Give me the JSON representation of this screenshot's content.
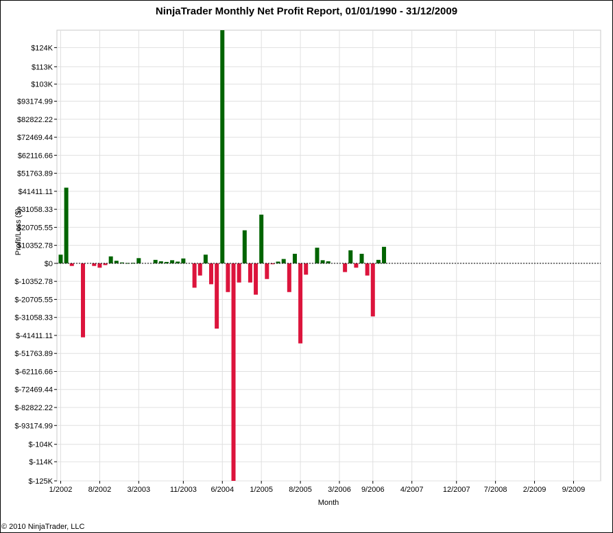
{
  "footer": "© 2010 NinjaTrader, LLC",
  "colors": {
    "positive": "#006400",
    "negative": "#DC143C",
    "grid": "#E0E0E0"
  },
  "chart_data": {
    "type": "bar",
    "title": "NinjaTrader Monthly Net Profit Report, 01/01/1990 - 31/12/2009",
    "xlabel": "Month",
    "ylabel": "Profit/Loss ($)",
    "grid": true,
    "ylim": [
      -125000,
      134000
    ],
    "y_tick_values": [
      124000,
      113000,
      103000,
      93174.99,
      82822.22,
      72469.44,
      62116.66,
      51763.89,
      41411.11,
      31058.33,
      20705.55,
      10352.78,
      0,
      -10352.78,
      -20705.55,
      -31058.33,
      -41411.11,
      -51763.89,
      -62116.66,
      -72469.44,
      -82822.22,
      -93174.99,
      -104000,
      -114000,
      -125000
    ],
    "y_tick_labels": [
      "$124K",
      "$113K",
      "$103K",
      "$93174.99",
      "$82822.22",
      "$72469.44",
      "$62116.66",
      "$51763.89",
      "$41411.11",
      "$31058.33",
      "$20705.55",
      "$10352.78",
      "$0",
      "$-10352.78",
      "$-20705.55",
      "$-31058.33",
      "$-41411.11",
      "$-51763.89",
      "$-62116.66",
      "$-72469.44",
      "$-82822.22",
      "$-93174.99",
      "$-104K",
      "$-114K",
      "$-125K"
    ],
    "x_tick_labels": [
      "1/2002",
      "8/2002",
      "3/2003",
      "11/2003",
      "6/2004",
      "1/2005",
      "8/2005",
      "3/2006",
      "9/2006",
      "4/2007",
      "12/2007",
      "7/2008",
      "2/2009",
      "9/2009"
    ],
    "x_tick_month_index": [
      0,
      7,
      14,
      22,
      29,
      36,
      43,
      50,
      56,
      63,
      71,
      78,
      85,
      92
    ],
    "x_month_count": 96,
    "values": [
      5000,
      43500,
      -1500,
      0,
      -42500,
      0,
      -1500,
      -2500,
      -1000,
      4000,
      1500,
      500,
      200,
      300,
      3000,
      0,
      0,
      2000,
      1200,
      800,
      1800,
      1000,
      2800,
      0,
      -14000,
      -7000,
      5000,
      -12000,
      -37500,
      134000,
      -16500,
      -125000,
      -11000,
      19000,
      -11000,
      -18000,
      28000,
      -9000,
      -500,
      1000,
      2500,
      -16500,
      5500,
      -46000,
      -6500,
      0,
      9000,
      1800,
      1200,
      0,
      0,
      -5000,
      7500,
      -2500,
      5500,
      -7000,
      -30500,
      2000,
      9500
    ]
  }
}
